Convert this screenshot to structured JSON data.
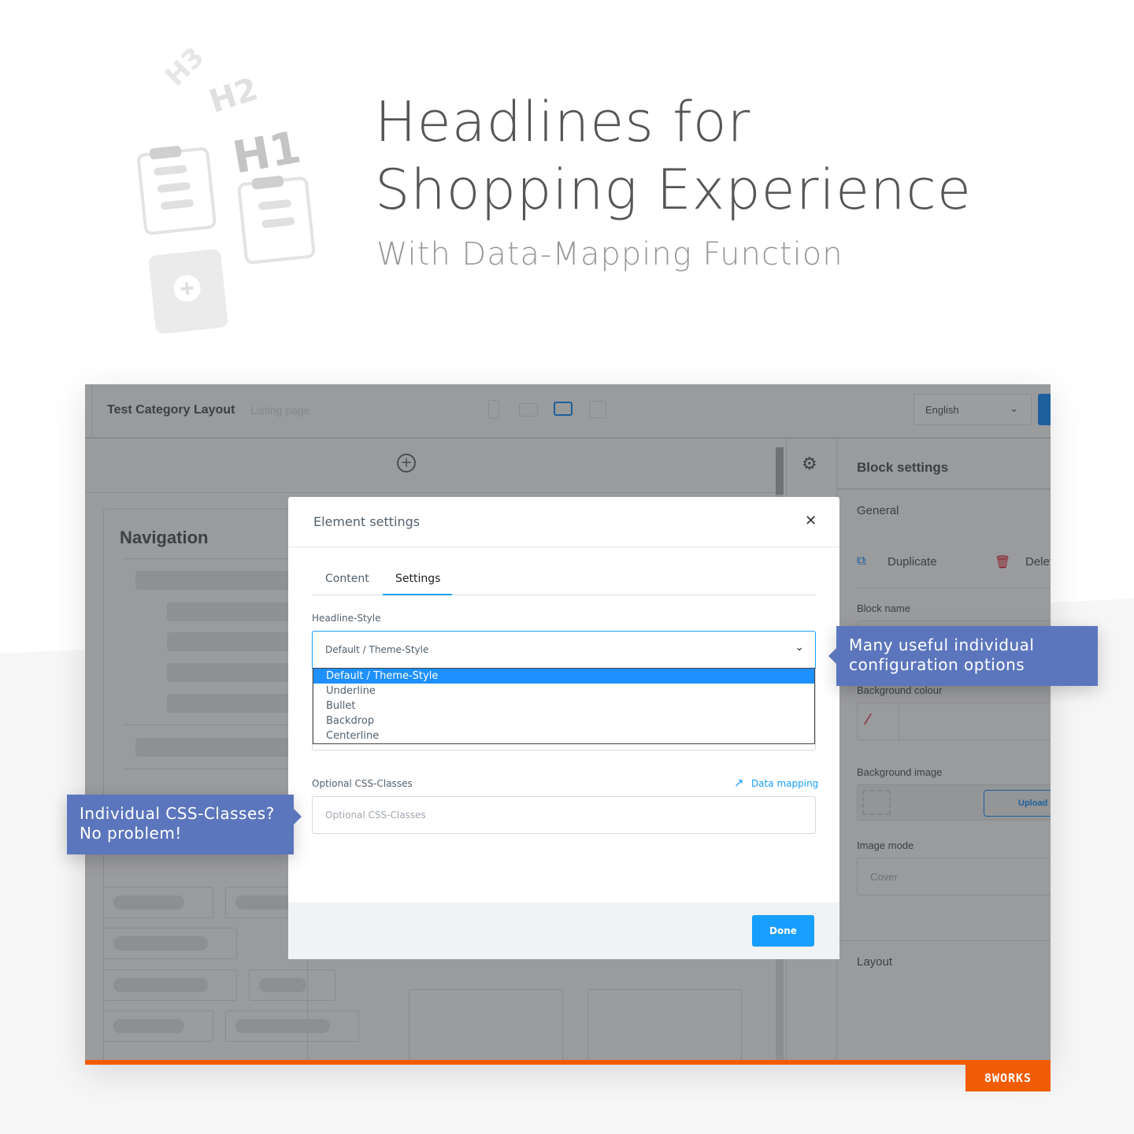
{
  "hero": {
    "title_line1": "Headlines for",
    "title_line2": "Shopping Experience",
    "subtitle": "With Data-Mapping Function",
    "illustration_labels": [
      "H3",
      "H2",
      "H1"
    ]
  },
  "app": {
    "title": "Test Category Layout",
    "subtitle": "Listing page",
    "language": "English",
    "left_panel": {
      "title": "Navigation"
    },
    "right_panel": {
      "title": "Block settings",
      "general": "General",
      "duplicate": "Duplicate",
      "delete": "Delete",
      "block_name": "Block name",
      "background_colour": "Background colour",
      "background_image": "Background image",
      "upload": "Upload",
      "image_mode": "Image mode",
      "image_mode_value": "Cover",
      "layout": "Layout"
    }
  },
  "modal": {
    "title": "Element settings",
    "tabs": [
      "Content",
      "Settings"
    ],
    "active_tab": "Settings",
    "headline_style_label": "Headline-Style",
    "headline_style_value": "Default / Theme-Style",
    "options": [
      "Default / Theme-Style",
      "Underline",
      "Bullet",
      "Backdrop",
      "Centerline"
    ],
    "css_label": "Optional CSS-Classes",
    "data_mapping": "Data mapping",
    "css_placeholder": "Optional CSS-Classes",
    "done": "Done"
  },
  "callouts": {
    "right": [
      "Many useful individual",
      "configuration options"
    ],
    "left": [
      "Individual CSS-Classes?",
      "No problem!"
    ]
  },
  "logo": "8WORKS",
  "colors": {
    "accent": "#189eff",
    "callout": "#5c76bd",
    "brand": "#f25c05"
  }
}
